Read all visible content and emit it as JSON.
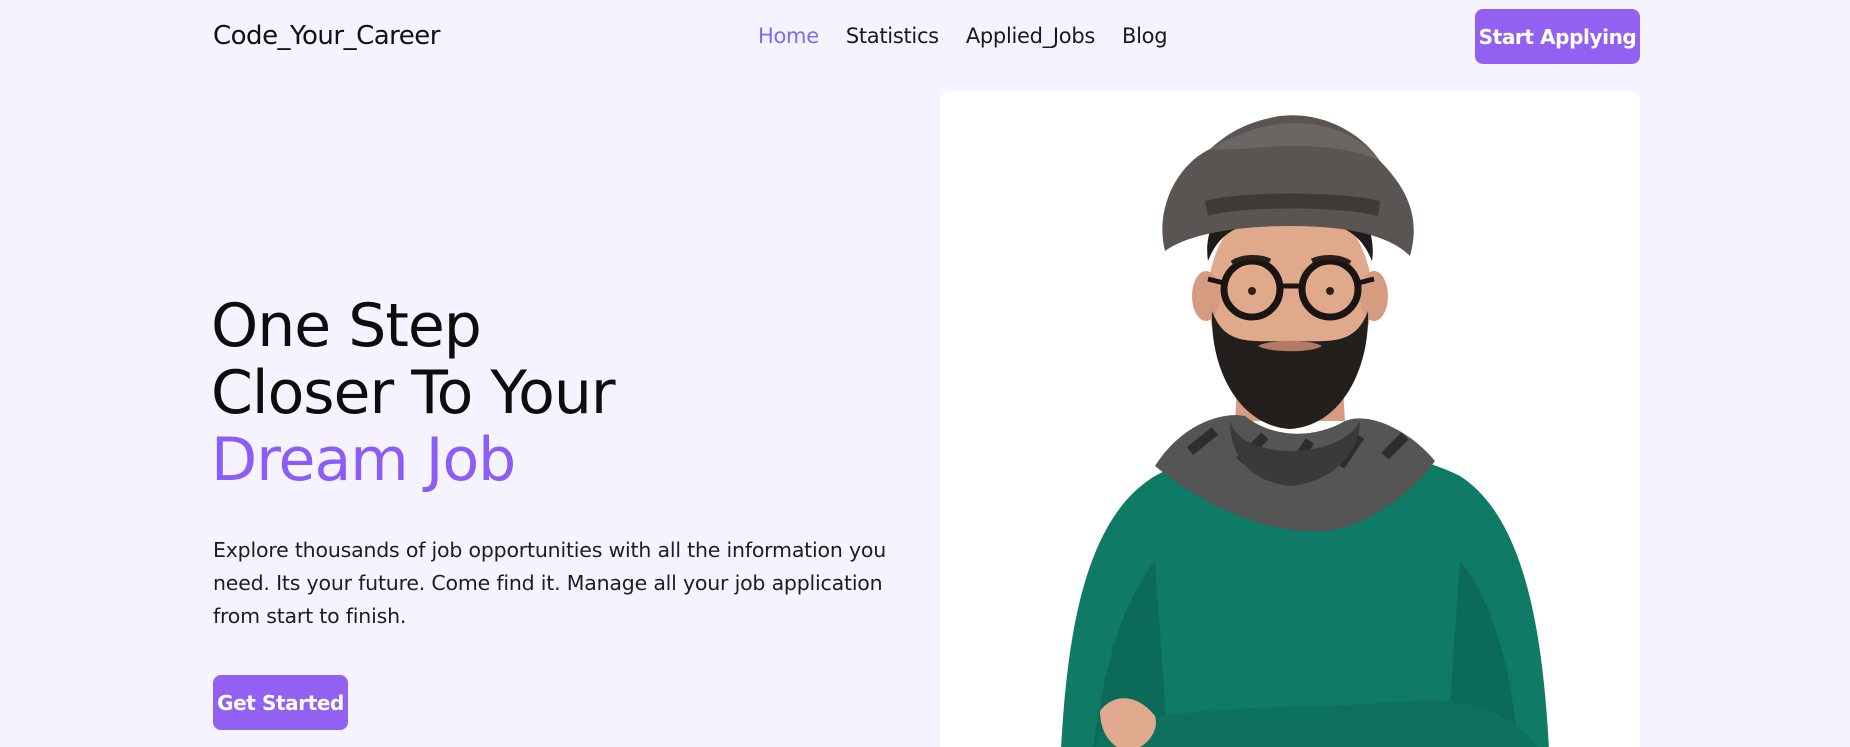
{
  "header": {
    "brand": "Code_Your_Career",
    "nav": [
      {
        "label": "Home",
        "active": true
      },
      {
        "label": "Statistics",
        "active": false
      },
      {
        "label": "Applied_Jobs",
        "active": false
      },
      {
        "label": "Blog",
        "active": false
      }
    ],
    "cta_label": "Start Applying"
  },
  "hero": {
    "title_line1": "One Step",
    "title_line2": "Closer To Your",
    "title_accent": "Dream Job",
    "description": "Explore thousands of job opportunities with all the information you need. Its your future. Come find it. Manage all your job application from start to finish.",
    "cta_label": "Get Started",
    "image": "man-with-hat-glasses-scarf"
  },
  "colors": {
    "accent": "#8b5cf6",
    "button": "#9361f2",
    "background": "#f5f3ff",
    "nav_active": "#7c6cf0"
  }
}
